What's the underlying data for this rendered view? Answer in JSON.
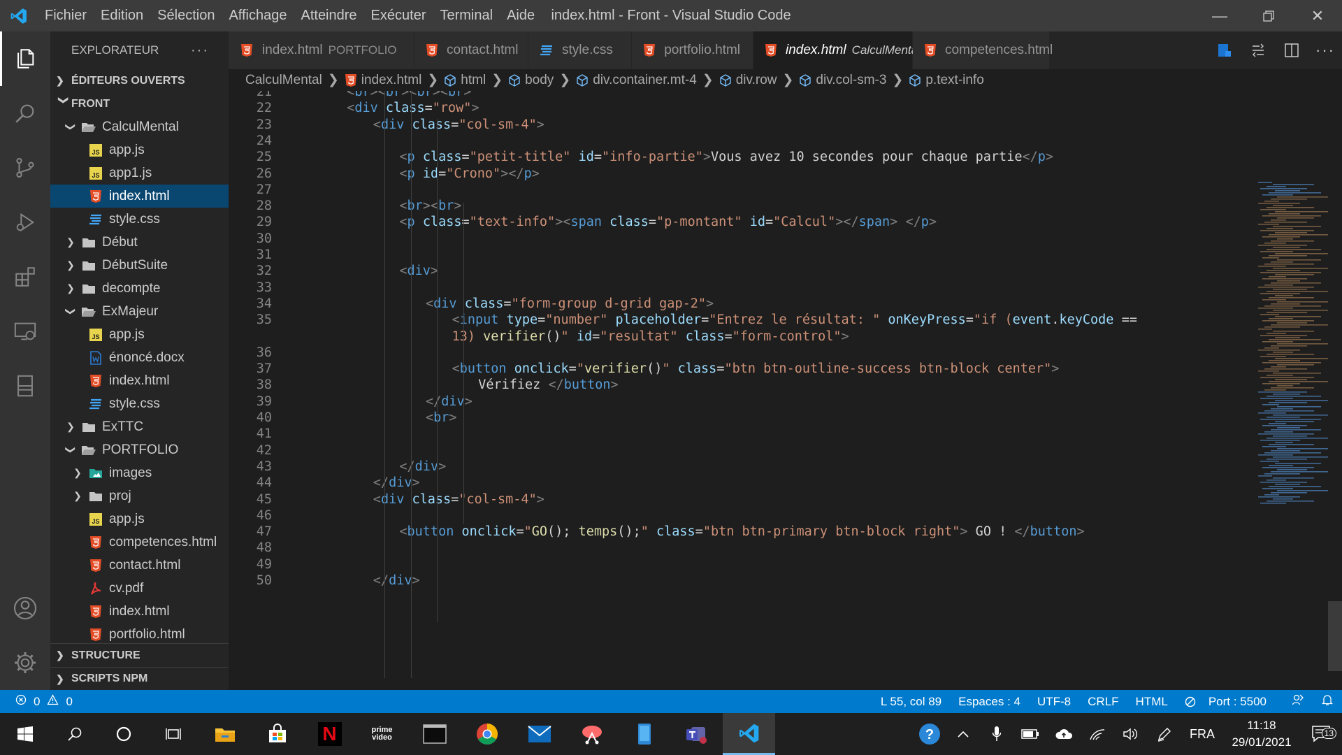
{
  "window": {
    "title": "index.html - Front - Visual Studio Code",
    "menu": [
      "Fichier",
      "Edition",
      "Sélection",
      "Affichage",
      "Atteindre",
      "Exécuter",
      "Terminal",
      "Aide"
    ]
  },
  "sidebar": {
    "header": "EXPLORATEUR",
    "open_editors": "ÉDITEURS OUVERTS",
    "workspace": "FRONT",
    "tree": [
      {
        "label": "CalculMental",
        "type": "folder-open",
        "depth": 1
      },
      {
        "label": "app.js",
        "type": "js",
        "depth": 2
      },
      {
        "label": "app1.js",
        "type": "js",
        "depth": 2
      },
      {
        "label": "index.html",
        "type": "html",
        "depth": 2,
        "selected": true
      },
      {
        "label": "style.css",
        "type": "css",
        "depth": 2
      },
      {
        "label": "Début",
        "type": "folder",
        "depth": 1
      },
      {
        "label": "DébutSuite",
        "type": "folder",
        "depth": 1
      },
      {
        "label": "decompte",
        "type": "folder",
        "depth": 1
      },
      {
        "label": "ExMajeur",
        "type": "folder-open",
        "depth": 1
      },
      {
        "label": "app.js",
        "type": "js",
        "depth": 2
      },
      {
        "label": "énoncé.docx",
        "type": "docx",
        "depth": 2
      },
      {
        "label": "index.html",
        "type": "html",
        "depth": 2
      },
      {
        "label": "style.css",
        "type": "css",
        "depth": 2
      },
      {
        "label": "ExTTC",
        "type": "folder",
        "depth": 1
      },
      {
        "label": "PORTFOLIO",
        "type": "folder-open",
        "depth": 1
      },
      {
        "label": "images",
        "type": "folder-img",
        "depth": 2
      },
      {
        "label": "proj",
        "type": "folder",
        "depth": 2
      },
      {
        "label": "app.js",
        "type": "js",
        "depth": 2
      },
      {
        "label": "competences.html",
        "type": "html",
        "depth": 2
      },
      {
        "label": "contact.html",
        "type": "html",
        "depth": 2
      },
      {
        "label": "cv.pdf",
        "type": "pdf",
        "depth": 2
      },
      {
        "label": "index.html",
        "type": "html",
        "depth": 2
      },
      {
        "label": "portfolio.html",
        "type": "html",
        "depth": 2
      }
    ],
    "structure": "STRUCTURE",
    "npm": "SCRIPTS NPM"
  },
  "tabs": [
    {
      "label": "index.html",
      "desc": "PORTFOLIO",
      "type": "html"
    },
    {
      "label": "contact.html",
      "desc": "",
      "type": "html"
    },
    {
      "label": "style.css",
      "desc": "",
      "type": "css"
    },
    {
      "label": "portfolio.html",
      "desc": "",
      "type": "html"
    },
    {
      "label": "index.html",
      "desc": "CalculMental",
      "type": "html",
      "active": true
    },
    {
      "label": "competences.html",
      "desc": "",
      "type": "html"
    }
  ],
  "breadcrumb": [
    "CalculMental",
    "index.html",
    "html",
    "body",
    "div.container.mt-4",
    "div.row",
    "div.col-sm-3",
    "p.text-info"
  ],
  "editor": {
    "lines": [
      {
        "n": "21",
        "partial_top": true,
        "indent": 2,
        "tokens": [
          [
            "t",
            "<"
          ],
          [
            "tag",
            "br"
          ],
          [
            "t",
            "><"
          ],
          [
            "tag",
            "br"
          ],
          [
            "t",
            "><"
          ],
          [
            "tag",
            "br"
          ],
          [
            "t",
            "><"
          ],
          [
            "tag",
            "br"
          ],
          [
            "t",
            ">"
          ]
        ]
      },
      {
        "n": "22",
        "indent": 2,
        "tokens": [
          [
            "t",
            "<"
          ],
          [
            "tag",
            "div"
          ],
          [
            "txt",
            " "
          ],
          [
            "attr",
            "class"
          ],
          [
            "txt",
            "="
          ],
          [
            "str",
            "\"row\""
          ],
          [
            "t",
            ">"
          ]
        ]
      },
      {
        "n": "23",
        "indent": 3,
        "tokens": [
          [
            "t",
            "<"
          ],
          [
            "tag",
            "div"
          ],
          [
            "txt",
            " "
          ],
          [
            "attr",
            "class"
          ],
          [
            "txt",
            "="
          ],
          [
            "str",
            "\"col-sm-4\""
          ],
          [
            "t",
            ">"
          ]
        ]
      },
      {
        "n": "24",
        "indent": 0,
        "tokens": []
      },
      {
        "n": "25",
        "indent": 4,
        "tokens": [
          [
            "t",
            "<"
          ],
          [
            "tag",
            "p"
          ],
          [
            "txt",
            " "
          ],
          [
            "attr",
            "class"
          ],
          [
            "txt",
            "="
          ],
          [
            "str",
            "\"petit-title\""
          ],
          [
            "txt",
            " "
          ],
          [
            "attr",
            "id"
          ],
          [
            "txt",
            "="
          ],
          [
            "str",
            "\"info-partie\""
          ],
          [
            "t",
            ">"
          ],
          [
            "txt",
            "Vous avez 10 secondes pour chaque partie"
          ],
          [
            "t",
            "</"
          ],
          [
            "tag",
            "p"
          ],
          [
            "t",
            ">"
          ]
        ]
      },
      {
        "n": "26",
        "indent": 4,
        "tokens": [
          [
            "t",
            "<"
          ],
          [
            "tag",
            "p"
          ],
          [
            "txt",
            " "
          ],
          [
            "attr",
            "id"
          ],
          [
            "txt",
            "="
          ],
          [
            "str",
            "\"Crono\""
          ],
          [
            "t",
            "></"
          ],
          [
            "tag",
            "p"
          ],
          [
            "t",
            ">"
          ]
        ]
      },
      {
        "n": "27",
        "indent": 0,
        "tokens": []
      },
      {
        "n": "28",
        "indent": 4,
        "tokens": [
          [
            "t",
            "<"
          ],
          [
            "tag",
            "br"
          ],
          [
            "t",
            "><"
          ],
          [
            "tag",
            "br"
          ],
          [
            "t",
            ">"
          ]
        ]
      },
      {
        "n": "29",
        "indent": 4,
        "tokens": [
          [
            "t",
            "<"
          ],
          [
            "tag",
            "p"
          ],
          [
            "txt",
            " "
          ],
          [
            "attr",
            "class"
          ],
          [
            "txt",
            "="
          ],
          [
            "str",
            "\"text-info\""
          ],
          [
            "t",
            "><"
          ],
          [
            "tag",
            "span"
          ],
          [
            "txt",
            " "
          ],
          [
            "attr",
            "class"
          ],
          [
            "txt",
            "="
          ],
          [
            "str",
            "\"p-montant\""
          ],
          [
            "txt",
            " "
          ],
          [
            "attr",
            "id"
          ],
          [
            "txt",
            "="
          ],
          [
            "str",
            "\"Calcul\""
          ],
          [
            "t",
            "></"
          ],
          [
            "tag",
            "span"
          ],
          [
            "t",
            ">"
          ],
          [
            "txt",
            " "
          ],
          [
            "t",
            "</"
          ],
          [
            "tag",
            "p"
          ],
          [
            "t",
            ">"
          ]
        ]
      },
      {
        "n": "30",
        "indent": 0,
        "tokens": []
      },
      {
        "n": "31",
        "indent": 0,
        "tokens": []
      },
      {
        "n": "32",
        "indent": 4,
        "tokens": [
          [
            "t",
            "<"
          ],
          [
            "tag",
            "div"
          ],
          [
            "t",
            ">"
          ]
        ]
      },
      {
        "n": "33",
        "indent": 0,
        "tokens": []
      },
      {
        "n": "34",
        "indent": 5,
        "tokens": [
          [
            "t",
            "<"
          ],
          [
            "tag",
            "div"
          ],
          [
            "txt",
            " "
          ],
          [
            "attr",
            "class"
          ],
          [
            "txt",
            "="
          ],
          [
            "str",
            "\"form-group d-grid gap-2\""
          ],
          [
            "t",
            ">"
          ]
        ]
      },
      {
        "n": "35",
        "indent": 6,
        "tokens": [
          [
            "t",
            "<"
          ],
          [
            "tag",
            "input"
          ],
          [
            "txt",
            " "
          ],
          [
            "attr",
            "type"
          ],
          [
            "txt",
            "="
          ],
          [
            "str",
            "\"number\""
          ],
          [
            "txt",
            " "
          ],
          [
            "attr",
            "placeholder"
          ],
          [
            "txt",
            "="
          ],
          [
            "str",
            "\"Entrez le résultat: \""
          ],
          [
            "txt",
            " "
          ],
          [
            "attr",
            "onKeyPress"
          ],
          [
            "txt",
            "="
          ],
          [
            "str",
            "\"if ("
          ],
          [
            "attr",
            "event"
          ],
          [
            "txt",
            "."
          ],
          [
            "attr",
            "keyCode"
          ],
          [
            "txt",
            " =="
          ]
        ]
      },
      {
        "n": "",
        "indent": 6,
        "tokens": [
          [
            "str",
            "13) "
          ],
          [
            "fn",
            "verifier"
          ],
          [
            "txt",
            "()"
          ],
          [
            "str",
            "\""
          ],
          [
            "txt",
            " "
          ],
          [
            "attr",
            "id"
          ],
          [
            "txt",
            "="
          ],
          [
            "str",
            "\"resultat\""
          ],
          [
            "txt",
            " "
          ],
          [
            "attr",
            "class"
          ],
          [
            "txt",
            "="
          ],
          [
            "str",
            "\"form-control\""
          ],
          [
            "t",
            ">"
          ]
        ]
      },
      {
        "n": "36",
        "indent": 0,
        "tokens": []
      },
      {
        "n": "37",
        "indent": 6,
        "tokens": [
          [
            "t",
            "<"
          ],
          [
            "tag",
            "button"
          ],
          [
            "txt",
            " "
          ],
          [
            "attr",
            "onclick"
          ],
          [
            "txt",
            "="
          ],
          [
            "str",
            "\""
          ],
          [
            "fn",
            "verifier"
          ],
          [
            "txt",
            "()"
          ],
          [
            "str",
            "\""
          ],
          [
            "txt",
            " "
          ],
          [
            "attr",
            "class"
          ],
          [
            "txt",
            "="
          ],
          [
            "str",
            "\"btn btn-outline-success btn-block center\""
          ],
          [
            "t",
            ">"
          ]
        ]
      },
      {
        "n": "38",
        "indent": 7,
        "tokens": [
          [
            "txt",
            "Vérifiez "
          ],
          [
            "t",
            "</"
          ],
          [
            "tag",
            "button"
          ],
          [
            "t",
            ">"
          ]
        ]
      },
      {
        "n": "39",
        "indent": 5,
        "tokens": [
          [
            "t",
            "</"
          ],
          [
            "tag",
            "div"
          ],
          [
            "t",
            ">"
          ]
        ]
      },
      {
        "n": "40",
        "indent": 5,
        "tokens": [
          [
            "t",
            "<"
          ],
          [
            "tag",
            "br"
          ],
          [
            "t",
            ">"
          ]
        ]
      },
      {
        "n": "41",
        "indent": 0,
        "tokens": []
      },
      {
        "n": "42",
        "indent": 0,
        "tokens": []
      },
      {
        "n": "43",
        "indent": 4,
        "tokens": [
          [
            "t",
            "</"
          ],
          [
            "tag",
            "div"
          ],
          [
            "t",
            ">"
          ]
        ]
      },
      {
        "n": "44",
        "indent": 3,
        "tokens": [
          [
            "t",
            "</"
          ],
          [
            "tag",
            "div"
          ],
          [
            "t",
            ">"
          ]
        ]
      },
      {
        "n": "45",
        "indent": 3,
        "tokens": [
          [
            "t",
            "<"
          ],
          [
            "tag",
            "div"
          ],
          [
            "txt",
            " "
          ],
          [
            "attr",
            "class"
          ],
          [
            "txt",
            "="
          ],
          [
            "str",
            "\"col-sm-4\""
          ],
          [
            "t",
            ">"
          ]
        ]
      },
      {
        "n": "46",
        "indent": 0,
        "tokens": []
      },
      {
        "n": "47",
        "indent": 4,
        "tokens": [
          [
            "t",
            "<"
          ],
          [
            "tag",
            "button"
          ],
          [
            "txt",
            " "
          ],
          [
            "attr",
            "onclick"
          ],
          [
            "txt",
            "="
          ],
          [
            "str",
            "\""
          ],
          [
            "fn",
            "GO"
          ],
          [
            "txt",
            "(); "
          ],
          [
            "fn",
            "temps"
          ],
          [
            "txt",
            "();"
          ],
          [
            "str",
            "\""
          ],
          [
            "txt",
            " "
          ],
          [
            "attr",
            "class"
          ],
          [
            "txt",
            "="
          ],
          [
            "str",
            "\"btn btn-primary btn-block right\""
          ],
          [
            "t",
            ">"
          ],
          [
            "txt",
            " GO ! "
          ],
          [
            "t",
            "</"
          ],
          [
            "tag",
            "button"
          ],
          [
            "t",
            ">"
          ]
        ]
      },
      {
        "n": "48",
        "indent": 0,
        "tokens": []
      },
      {
        "n": "49",
        "indent": 0,
        "tokens": []
      },
      {
        "n": "50",
        "indent": 3,
        "tokens": [
          [
            "t",
            "</"
          ],
          [
            "tag",
            "div"
          ],
          [
            "t",
            ">"
          ]
        ]
      }
    ]
  },
  "statusbar": {
    "errors": "0",
    "warnings": "0",
    "position": "L 55, col 89",
    "spaces": "Espaces : 4",
    "encoding": "UTF-8",
    "eol": "CRLF",
    "language": "HTML",
    "port": "Port : 5500"
  },
  "taskbar": {
    "lang": "FRA",
    "time": "11:18",
    "date": "29/01/2021",
    "notifications": "13",
    "prime_label": "prime video"
  },
  "colors": {
    "accent": "#007acc",
    "selection": "#094771"
  }
}
